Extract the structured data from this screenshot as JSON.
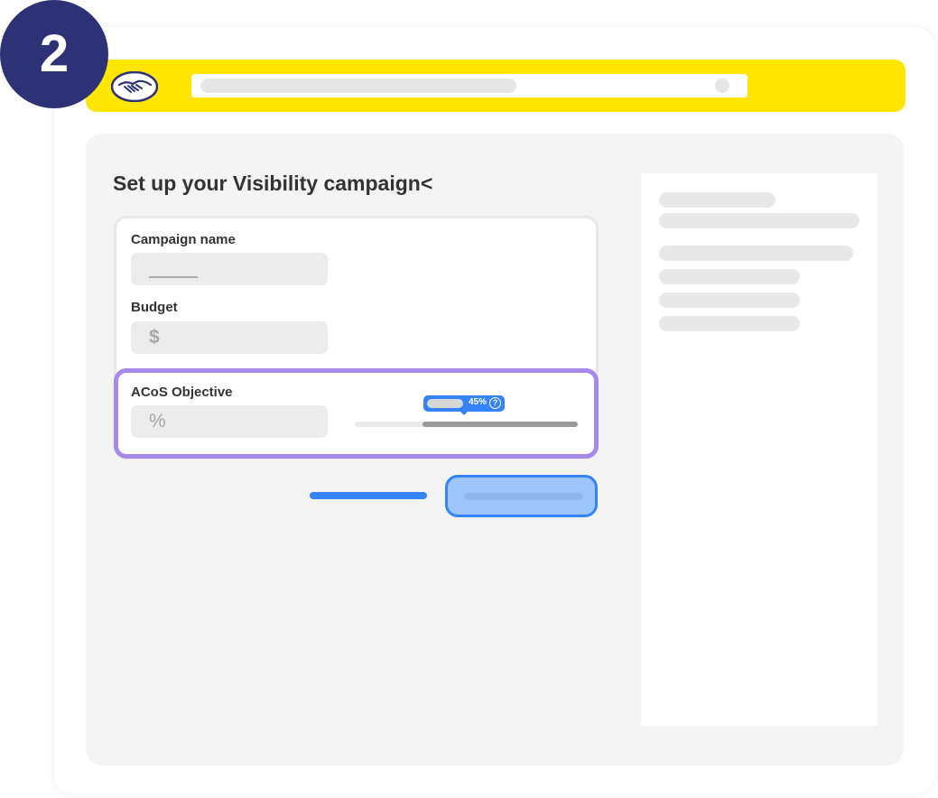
{
  "step": {
    "number": "2"
  },
  "header": {
    "brand_color": "#ffe600",
    "logo_icon": "handshake-icon",
    "search_icon": "search-icon"
  },
  "form": {
    "title": "Set up your Visibility campaign<",
    "campaign_name": {
      "label": "Campaign name",
      "value": ""
    },
    "budget": {
      "label": "Budget",
      "currency_symbol": "$"
    },
    "acos": {
      "label": "ACoS Objective",
      "unit_symbol": "%",
      "slider": {
        "tooltip_value": "45%",
        "help_icon": "?"
      }
    }
  },
  "colors": {
    "step_badge": "#2d3277",
    "accent": "#3483fa",
    "highlight": "#a689ea"
  }
}
